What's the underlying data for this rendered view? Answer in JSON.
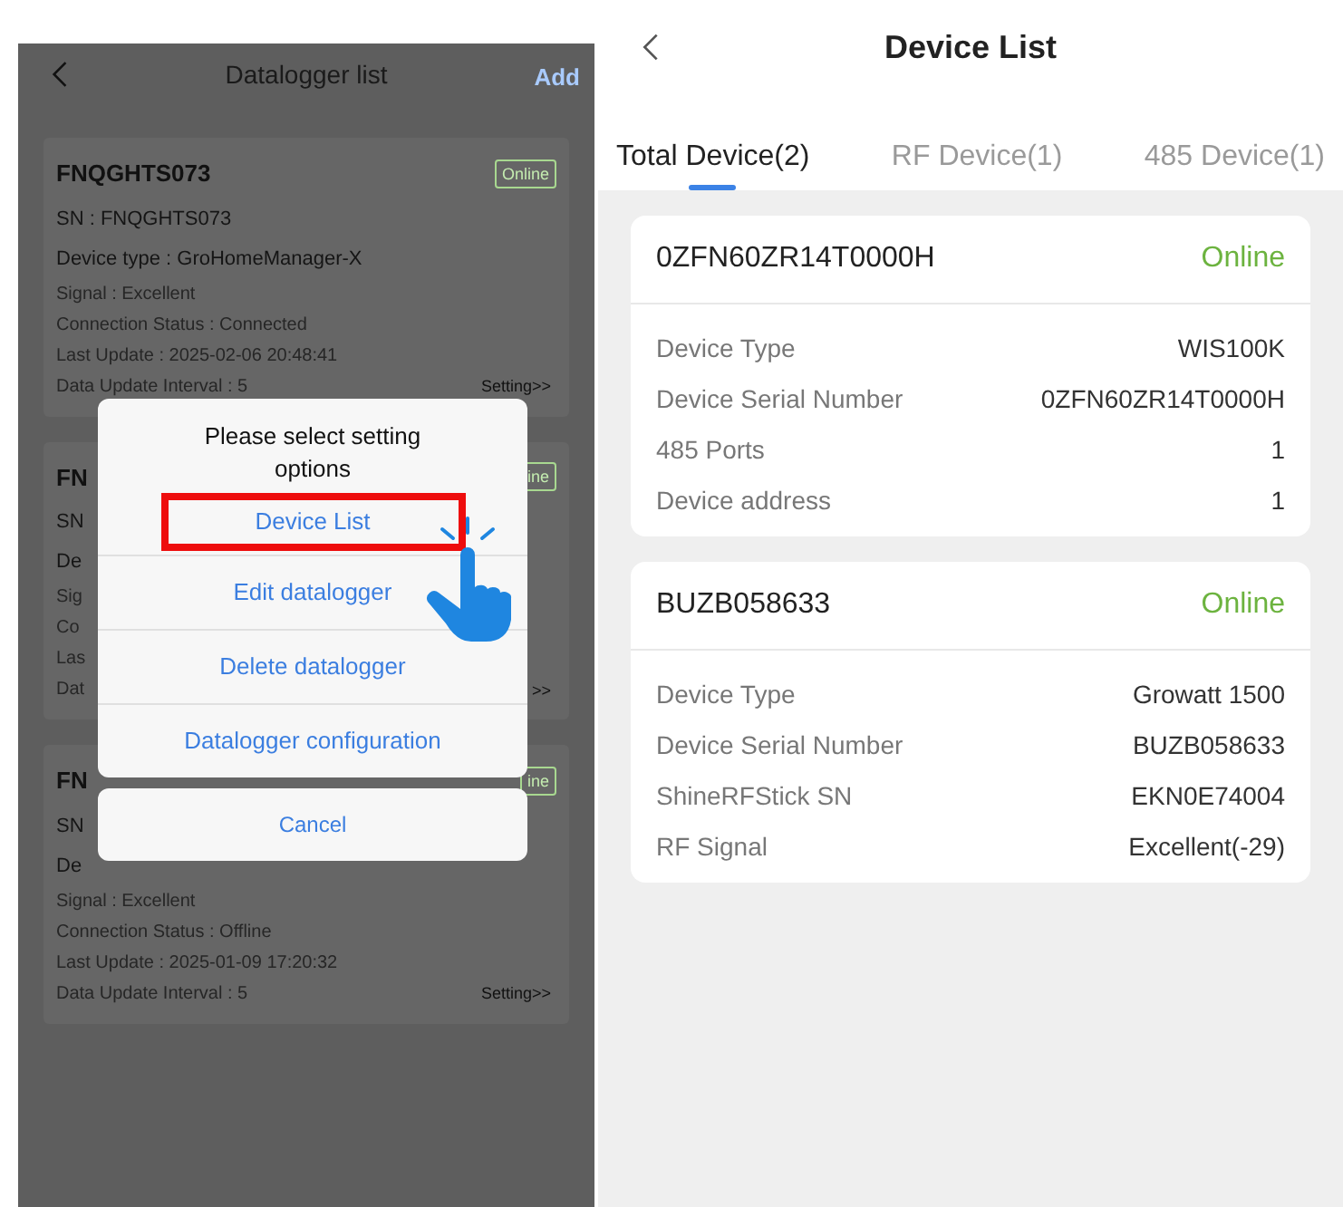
{
  "datalogger_screen": {
    "title": "Datalogger list",
    "action": "Add",
    "cards": [
      {
        "name": "FNQGHTS073",
        "badge": "Online",
        "setting": "Setting>>",
        "lines": [
          {
            "kind": "primary",
            "text": "SN : FNQGHTS073"
          },
          {
            "kind": "primary",
            "text": "Device type : GroHomeManager-X"
          },
          {
            "kind": "secondary",
            "text": "Signal : Excellent"
          },
          {
            "kind": "secondary",
            "text": "Connection Status : Connected"
          },
          {
            "kind": "secondary",
            "text": "Last Update : 2025-02-06 20:48:41"
          },
          {
            "kind": "secondary",
            "text": "Data Update Interval : 5"
          }
        ]
      },
      {
        "name": "FN",
        "badge": "ine",
        "setting": ">>",
        "lines": [
          {
            "kind": "primary",
            "text": "SN"
          },
          {
            "kind": "primary",
            "text": "De"
          },
          {
            "kind": "secondary",
            "text": "Sig"
          },
          {
            "kind": "secondary",
            "text": "Co"
          },
          {
            "kind": "secondary",
            "text": "Las"
          },
          {
            "kind": "secondary",
            "text": "Dat"
          }
        ]
      },
      {
        "name": "FN",
        "badge": "ine",
        "setting": "Setting>>",
        "lines": [
          {
            "kind": "primary",
            "text": "SN"
          },
          {
            "kind": "primary",
            "text": "De"
          },
          {
            "kind": "secondary",
            "text": "Signal : Excellent"
          },
          {
            "kind": "secondary",
            "text": "Connection Status : Offline"
          },
          {
            "kind": "secondary",
            "text": "Last Update : 2025-01-09 17:20:32"
          },
          {
            "kind": "secondary",
            "text": "Data Update Interval : 5"
          }
        ]
      }
    ],
    "dialog": {
      "title": "Please select setting options",
      "options": [
        {
          "label": "Device List",
          "highlighted": true
        },
        {
          "label": "Edit datalogger",
          "highlighted": false
        },
        {
          "label": "Delete datalogger",
          "highlighted": false
        },
        {
          "label": "Datalogger configuration",
          "highlighted": false
        }
      ],
      "cancel": "Cancel"
    }
  },
  "device_list_screen": {
    "title": "Device List",
    "tabs": [
      {
        "label": "Total Device(2)",
        "selected": true
      },
      {
        "label": "RF Device(1)",
        "selected": false
      },
      {
        "label": "485 Device(1)",
        "selected": false
      }
    ],
    "devices": [
      {
        "name": "0ZFN60ZR14T0000H",
        "status": "Online",
        "fields": [
          {
            "label": "Device Type",
            "value": "WIS100K"
          },
          {
            "label": "Device Serial Number",
            "value": "0ZFN60ZR14T0000H"
          },
          {
            "label": "485 Ports",
            "value": "1"
          },
          {
            "label": "Device address",
            "value": "1"
          }
        ]
      },
      {
        "name": "BUZB058633",
        "status": "Online",
        "fields": [
          {
            "label": "Device Type",
            "value": "Growatt 1500"
          },
          {
            "label": "Device Serial Number",
            "value": "BUZB058633"
          },
          {
            "label": "ShineRFStick SN",
            "value": "EKN0E74004"
          },
          {
            "label": "RF Signal",
            "value": "Excellent(-29)"
          }
        ]
      }
    ]
  }
}
